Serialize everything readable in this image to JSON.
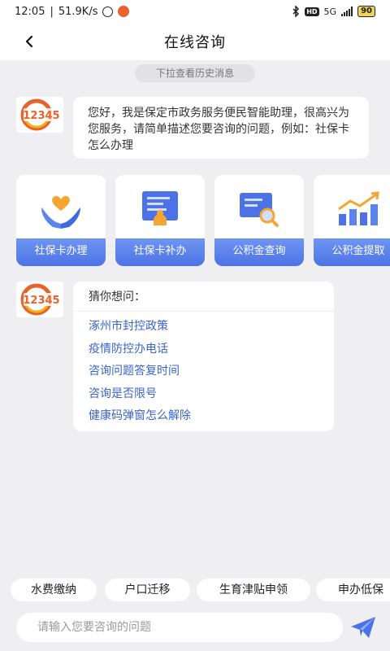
{
  "status_bar": {
    "time": "12:05",
    "speed": "51.9K/s",
    "network": "5G",
    "hd": "HD",
    "battery": "90"
  },
  "nav": {
    "title": "在线咨询",
    "back_icon": "chevron-left-icon"
  },
  "history_hint": "下拉查看历史消息",
  "avatar_logo_text": "12345",
  "welcome_message": "您好，我是保定市政务服务便民智能助理，很高兴为您服务，请简单描述您要咨询的问题，例如：社保卡怎么办理",
  "services": [
    {
      "label": "社保卡办理",
      "icon": "hands-heart-icon"
    },
    {
      "label": "社保卡补办",
      "icon": "id-card-icon"
    },
    {
      "label": "公积金查询",
      "icon": "document-search-icon"
    },
    {
      "label": "公积金提取",
      "icon": "bar-chart-trend-icon"
    }
  ],
  "suggestions": {
    "title": "猜你想问：",
    "items": [
      "涿州市封控政策",
      "疫情防控办电话",
      "咨询问题答复时间",
      "咨询是否限号",
      "健康码弹窗怎么解除"
    ]
  },
  "quick_chips": [
    "水费缴纳",
    "户口迁移",
    "生育津贴申领",
    "申办低保"
  ],
  "input": {
    "placeholder": "请输入您要咨询的问题",
    "value": ""
  },
  "send_icon": "paper-plane-icon",
  "colors": {
    "accent": "#4c72e6",
    "link": "#3a63c9",
    "background": "#efeff1",
    "logo_orange": "#e9622c"
  }
}
